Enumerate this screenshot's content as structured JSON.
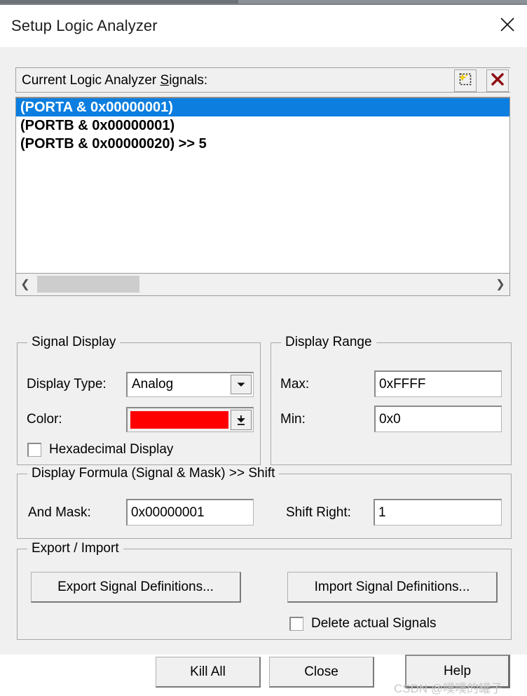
{
  "window": {
    "title": "Setup Logic Analyzer",
    "close_icon": "close-icon"
  },
  "signals_panel": {
    "header_label_prefix": "Current Logic Analyzer ",
    "header_label_accel": "S",
    "header_label_suffix": "ignals:",
    "header_label_full": "Current Logic Analyzer Signals:",
    "new_signal_icon": "new-signal-icon",
    "delete_signal_icon": "delete-signal-icon",
    "selection_color": "#0b7ee0",
    "items": [
      {
        "text": "(PORTA & 0x00000001)",
        "selected": true
      },
      {
        "text": "(PORTB & 0x00000001)",
        "selected": false
      },
      {
        "text": "(PORTB & 0x00000020) >> 5",
        "selected": false
      }
    ],
    "scrollbar": {
      "left_arrow_icon": "chevron-left-icon",
      "right_arrow_icon": "chevron-right-icon"
    }
  },
  "signal_display": {
    "group_title": "Signal Display",
    "display_type_label": "Display Type:",
    "display_type_value": "Analog",
    "display_type_arrow_icon": "chevron-down-icon",
    "color_label": "Color:",
    "color_value": "#ff0000",
    "color_arrow_icon": "color-dropdown-icon",
    "hexadecimal_label": "Hexadecimal Display",
    "hexadecimal_checked": false
  },
  "display_range": {
    "group_title": "Display Range",
    "max_label": "Max:",
    "max_value": "0xFFFF",
    "min_label": "Min:",
    "min_value": "0x0"
  },
  "display_formula": {
    "group_title": "Display Formula (Signal & Mask) >> Shift",
    "and_mask_label": "And Mask:",
    "and_mask_value": "0x00000001",
    "shift_right_label": "Shift Right:",
    "shift_right_value": "1"
  },
  "export_import": {
    "group_title": "Export / Import",
    "export_button": "Export Signal Definitions...",
    "import_button": "Import Signal Definitions...",
    "delete_actual_label": "Delete actual Signals",
    "delete_actual_checked": false
  },
  "footer": {
    "kill_all_button": "Kill All",
    "close_button": "Close",
    "help_button": "Help"
  },
  "watermark": {
    "text": "CSDN @噗噗的罐子"
  }
}
